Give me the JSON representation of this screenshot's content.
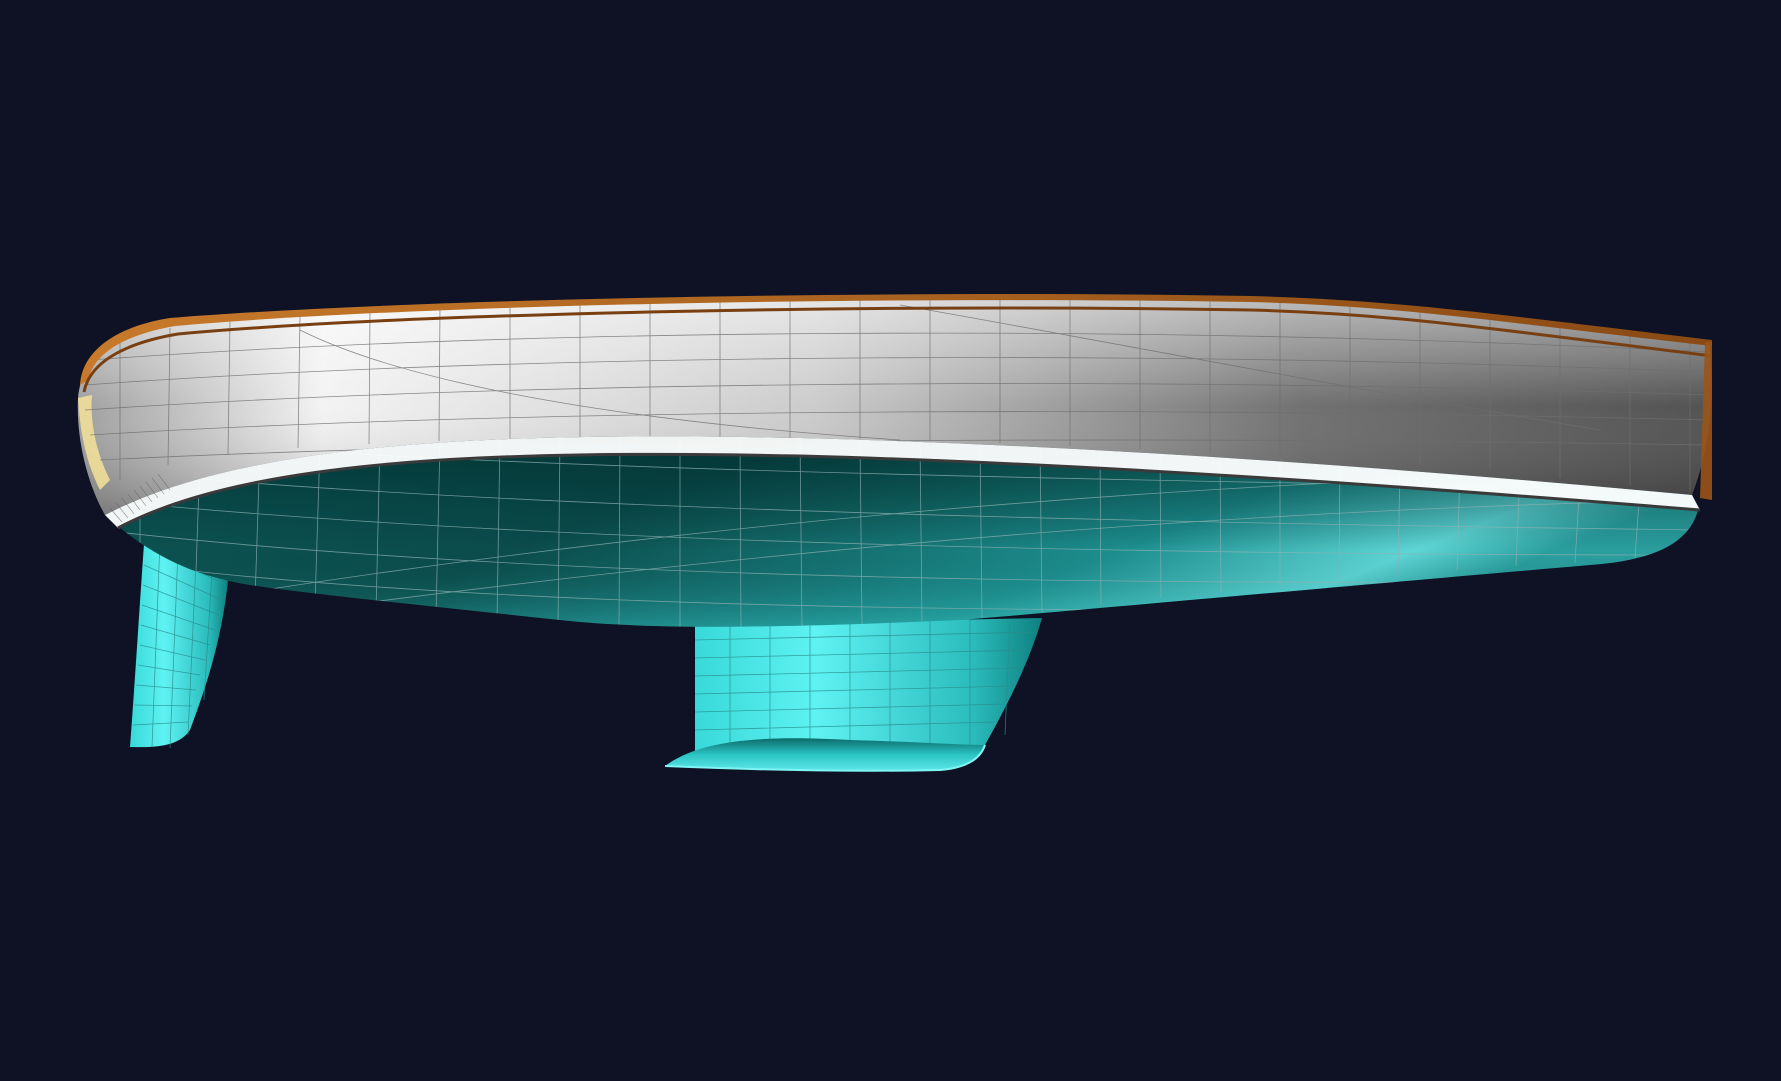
{
  "viewport": {
    "background": "#0f1224",
    "view_mode": "shaded-with-grid"
  },
  "hull_model": {
    "topsides_color": "#d9d9d9",
    "deck_edge_color": "#b5651d",
    "boot_stripe_color": "#ffffff",
    "underbody_color": "#0f6f6f",
    "appendage_color": "#45e6e6",
    "grid_line_color": "#9aa3a6",
    "parts": [
      "topsides",
      "sheer-strake",
      "boot-stripe",
      "underbody",
      "keel-fin",
      "keel-bulb",
      "rudder"
    ]
  }
}
